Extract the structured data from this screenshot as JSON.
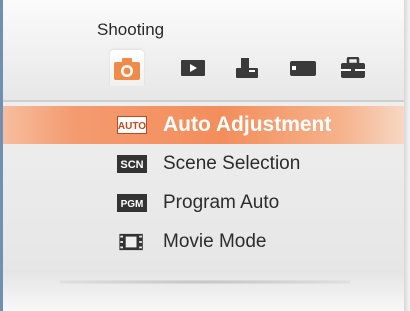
{
  "header": {
    "title": "Shooting",
    "tabs": [
      {
        "name": "tab-shooting",
        "icon": "camera-icon",
        "active": true
      },
      {
        "name": "tab-playback",
        "icon": "play-icon",
        "active": false
      },
      {
        "name": "tab-print",
        "icon": "print-icon",
        "active": false
      },
      {
        "name": "tab-memory",
        "icon": "memory-card-icon",
        "active": false
      },
      {
        "name": "tab-setup",
        "icon": "toolbox-icon",
        "active": false
      }
    ]
  },
  "menu": {
    "items": [
      {
        "label": "Auto Adjustment",
        "icon_text": "AUTO",
        "icon": "auto-mode-icon",
        "selected": true
      },
      {
        "label": "Scene Selection",
        "icon_text": "SCN",
        "icon": "scene-mode-icon",
        "selected": false
      },
      {
        "label": "Program Auto",
        "icon_text": "PGM",
        "icon": "program-mode-icon",
        "selected": false
      },
      {
        "label": "Movie Mode",
        "icon": "film-icon",
        "selected": false
      }
    ]
  },
  "colors": {
    "accent": "#f38e5c",
    "tab_icon": "#3a3a3a",
    "active_tab_icon": "#f08a4b"
  }
}
